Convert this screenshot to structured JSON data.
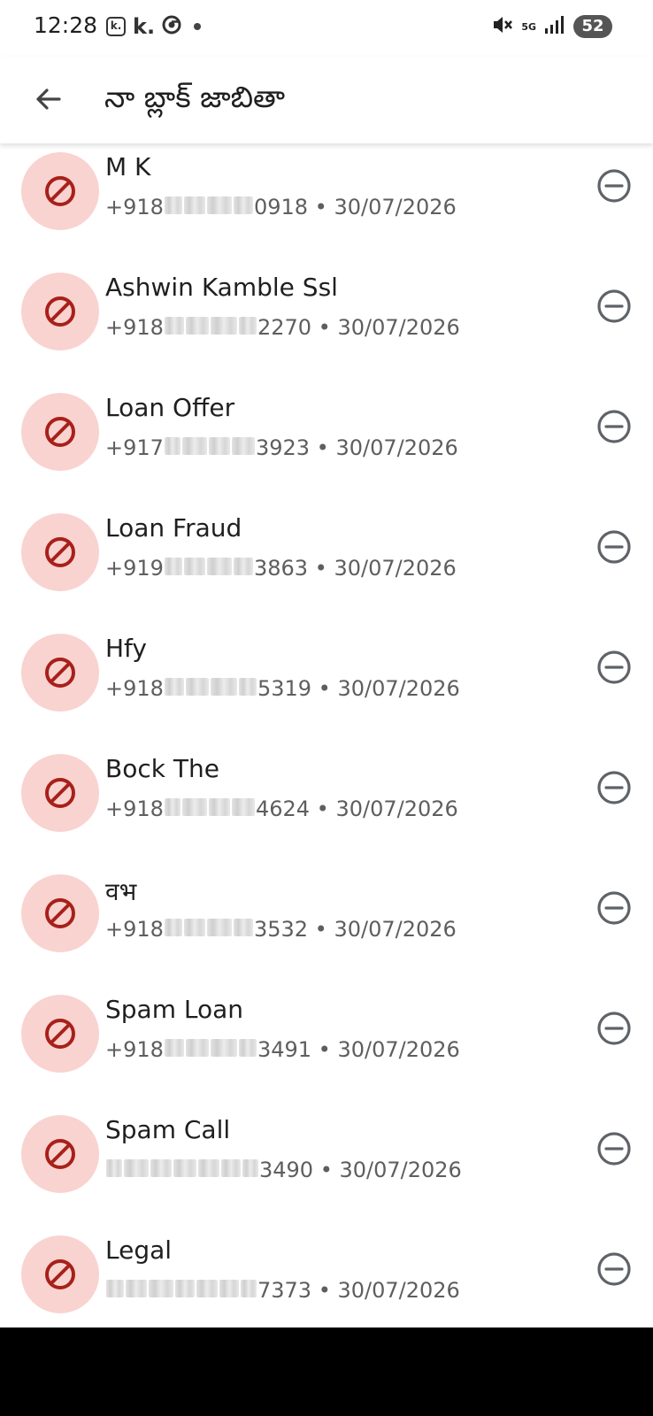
{
  "status_bar": {
    "time": "12:28",
    "notif_box_text": "k.",
    "notif_text": "k.",
    "network": "5G",
    "battery": "52"
  },
  "app_bar": {
    "title": "నా బ్లాక్ జాబితా"
  },
  "blocked": [
    {
      "name": "M K",
      "prefix": "+91",
      "hidden_first": "8",
      "suffix": "0918",
      "date": "30/07/2026"
    },
    {
      "name": "Ashwin Kamble Ssl",
      "prefix": "+91",
      "hidden_first": "8",
      "suffix": "2270",
      "date": "30/07/2026"
    },
    {
      "name": "Loan Offer",
      "prefix": "+91",
      "hidden_first": "7",
      "suffix": "3923",
      "date": "30/07/2026"
    },
    {
      "name": "Loan Fraud",
      "prefix": "+91",
      "hidden_first": "9",
      "suffix": "3863",
      "date": "30/07/2026"
    },
    {
      "name": "Hfy",
      "prefix": "+91",
      "hidden_first": "8",
      "suffix": "5319",
      "date": "30/07/2026"
    },
    {
      "name": "Bock The",
      "prefix": "+91",
      "hidden_first": "8",
      "suffix": "4624",
      "date": "30/07/2026"
    },
    {
      "name": "वभ",
      "prefix": "+91",
      "hidden_first": "8",
      "suffix": "3532",
      "date": "30/07/2026"
    },
    {
      "name": "Spam Loan",
      "prefix": "+91",
      "hidden_first": "8",
      "suffix": "3491",
      "date": "30/07/2026"
    },
    {
      "name": "Spam Call",
      "prefix": "",
      "hidden_first": "",
      "suffix": "3490",
      "date": "30/07/2026"
    },
    {
      "name": "Legal",
      "prefix": "",
      "hidden_first": "",
      "suffix": "7373",
      "date": "30/07/2026"
    }
  ],
  "separator": " • ",
  "colors": {
    "avatar_bg": "#f9d3d0",
    "block_icon": "#a8201a",
    "unblock_icon": "#5f6368"
  },
  "icons": {
    "avatar": "block-icon",
    "action": "remove-circle-icon",
    "back": "arrow-back-icon"
  }
}
